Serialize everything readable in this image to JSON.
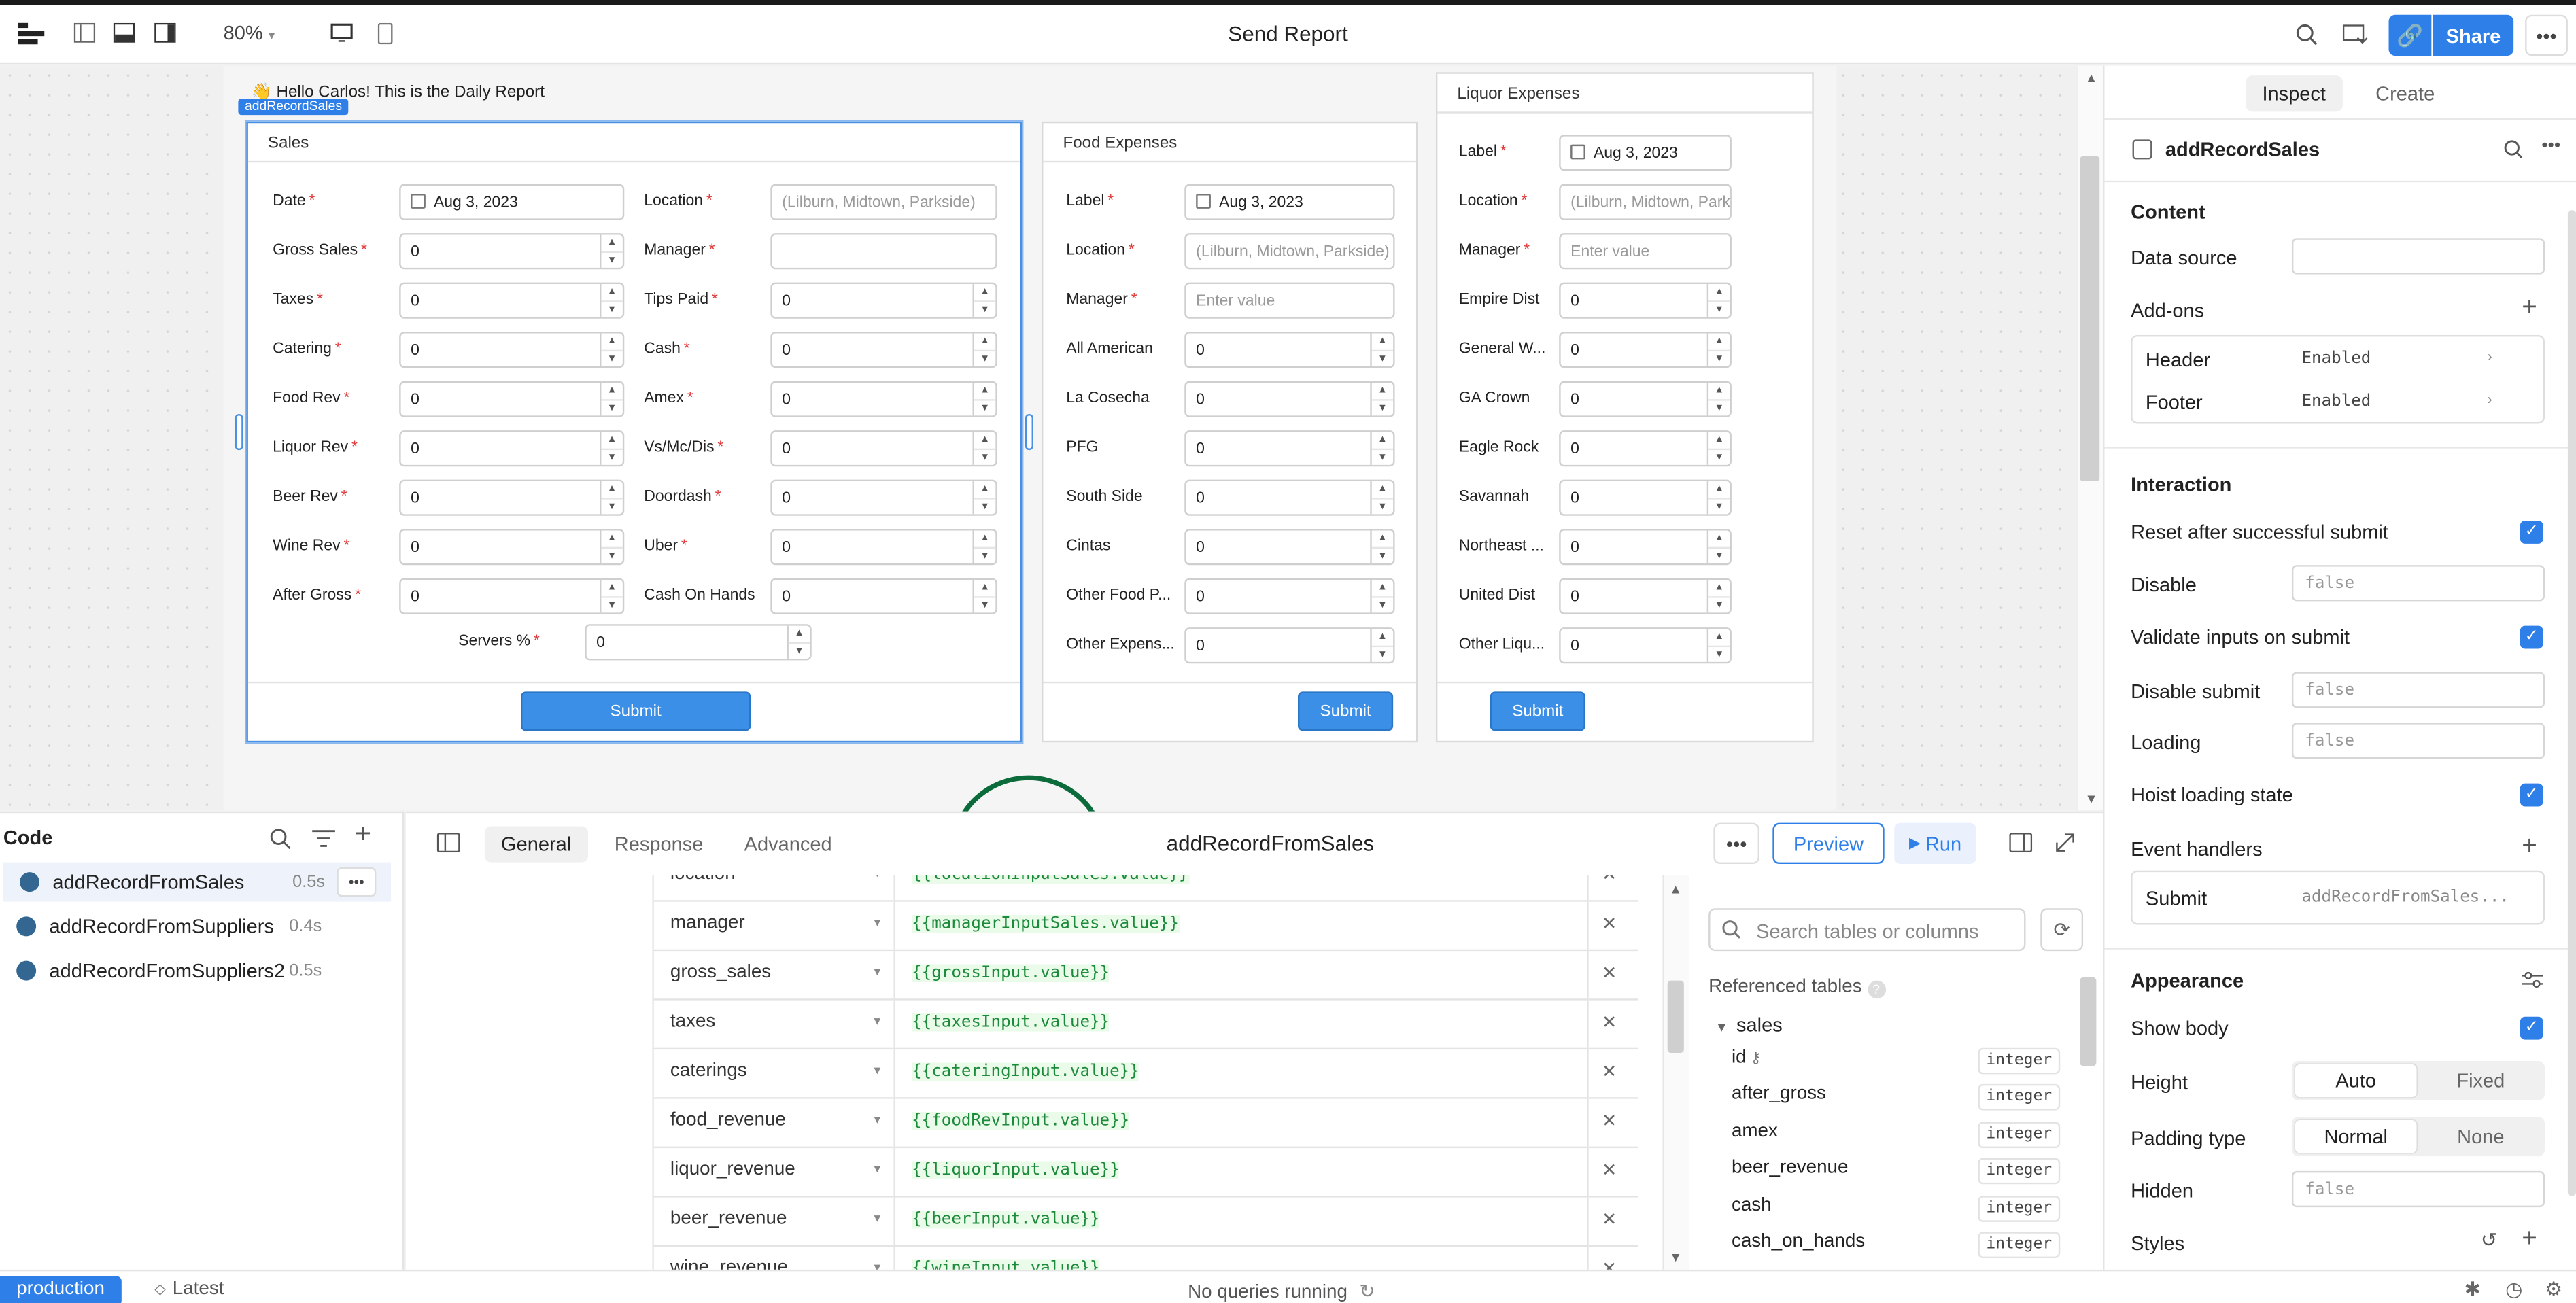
{
  "app": {
    "title": "Send Report",
    "zoom": "80%",
    "share_label": "Share"
  },
  "canvas": {
    "greeting": "👋 Hello Carlos! This is the Daily Report",
    "selected_badge": "addRecordSales"
  },
  "forms": {
    "sales": {
      "title": "Sales",
      "left_fields": [
        {
          "label": "Date",
          "required": true,
          "value": "Aug 3, 2023",
          "kind": "date"
        },
        {
          "label": "Gross Sales",
          "required": true,
          "value": "0",
          "kind": "number"
        },
        {
          "label": "Taxes",
          "required": true,
          "value": "0",
          "kind": "number"
        },
        {
          "label": "Catering",
          "required": true,
          "value": "0",
          "kind": "number"
        },
        {
          "label": "Food Rev",
          "required": true,
          "value": "0",
          "kind": "number"
        },
        {
          "label": "Liquor Rev",
          "required": true,
          "value": "0",
          "kind": "number"
        },
        {
          "label": "Beer Rev",
          "required": true,
          "value": "0",
          "kind": "number"
        },
        {
          "label": "Wine Rev",
          "required": true,
          "value": "0",
          "kind": "number"
        },
        {
          "label": "After Gross",
          "required": true,
          "value": "0",
          "kind": "number"
        }
      ],
      "right_fields": [
        {
          "label": "Location",
          "required": true,
          "value": "(Lilburn, Midtown, Parkside)",
          "kind": "placeholder"
        },
        {
          "label": "Manager",
          "required": true,
          "value": "",
          "kind": "text"
        },
        {
          "label": "Tips Paid",
          "required": true,
          "value": "0",
          "kind": "number"
        },
        {
          "label": "Cash",
          "required": true,
          "value": "0",
          "kind": "number"
        },
        {
          "label": "Amex",
          "required": true,
          "value": "0",
          "kind": "number"
        },
        {
          "label": "Vs/Mc/Dis",
          "required": true,
          "value": "0",
          "kind": "number"
        },
        {
          "label": "Doordash",
          "required": true,
          "value": "0",
          "kind": "number"
        },
        {
          "label": "Uber",
          "required": true,
          "value": "0",
          "kind": "number"
        },
        {
          "label": "Cash On Hands",
          "required": false,
          "value": "0",
          "kind": "number"
        }
      ],
      "servers": {
        "label": "Servers %",
        "required": true,
        "value": "0"
      },
      "submit_label": "Submit"
    },
    "food": {
      "title": "Food Expenses",
      "fields": [
        {
          "label": "Label",
          "required": true,
          "value": "Aug 3, 2023",
          "kind": "date"
        },
        {
          "label": "Location",
          "required": true,
          "value": "(Lilburn, Midtown, Parkside)",
          "kind": "placeholder"
        },
        {
          "label": "Manager",
          "required": true,
          "value": "Enter value",
          "kind": "placeholder"
        },
        {
          "label": "All American",
          "required": false,
          "value": "0",
          "kind": "number"
        },
        {
          "label": "La Cosecha",
          "required": false,
          "value": "0",
          "kind": "number"
        },
        {
          "label": "PFG",
          "required": false,
          "value": "0",
          "kind": "number"
        },
        {
          "label": "South Side",
          "required": false,
          "value": "0",
          "kind": "number"
        },
        {
          "label": "Cintas",
          "required": false,
          "value": "0",
          "kind": "number"
        },
        {
          "label": "Other Food P...",
          "required": false,
          "value": "0",
          "kind": "number"
        },
        {
          "label": "Other Expens...",
          "required": false,
          "value": "0",
          "kind": "number"
        }
      ],
      "submit_label": "Submit"
    },
    "liquor": {
      "title": "Liquor Expenses",
      "fields": [
        {
          "label": "Label",
          "required": true,
          "value": "Aug 3, 2023",
          "kind": "date"
        },
        {
          "label": "Location",
          "required": true,
          "value": "(Lilburn, Midtown, Parkside)",
          "kind": "placeholder"
        },
        {
          "label": "Manager",
          "required": true,
          "value": "Enter value",
          "kind": "placeholder"
        },
        {
          "label": "Empire Dist",
          "required": false,
          "value": "0",
          "kind": "number"
        },
        {
          "label": "General W...",
          "required": false,
          "value": "0",
          "kind": "number"
        },
        {
          "label": "GA Crown",
          "required": false,
          "value": "0",
          "kind": "number"
        },
        {
          "label": "Eagle Rock",
          "required": false,
          "value": "0",
          "kind": "number"
        },
        {
          "label": "Savannah",
          "required": false,
          "value": "0",
          "kind": "number"
        },
        {
          "label": "Northeast ...",
          "required": false,
          "value": "0",
          "kind": "number"
        },
        {
          "label": "United Dist",
          "required": false,
          "value": "0",
          "kind": "number"
        },
        {
          "label": "Other Liqu...",
          "required": false,
          "value": "0",
          "kind": "number"
        }
      ],
      "submit_label": "Submit"
    }
  },
  "inspector": {
    "tabs": [
      "Inspect",
      "Create"
    ],
    "component_name": "addRecordSales",
    "content_title": "Content",
    "data_source_label": "Data source",
    "addons_label": "Add-ons",
    "addons": [
      {
        "name": "Header",
        "value": "Enabled"
      },
      {
        "name": "Footer",
        "value": "Enabled"
      }
    ],
    "interaction_title": "Interaction",
    "interaction": {
      "reset_label": "Reset after successful submit",
      "disable_label": "Disable",
      "disable_value": "false",
      "validate_label": "Validate inputs on submit",
      "disable_submit_label": "Disable submit",
      "disable_submit_value": "false",
      "loading_label": "Loading",
      "loading_value": "false",
      "hoist_label": "Hoist loading state"
    },
    "event_handlers_label": "Event handlers",
    "event_handler": {
      "event": "Submit",
      "action": "addRecordFromSales..."
    },
    "appearance_title": "Appearance",
    "appearance": {
      "show_body_label": "Show body",
      "height_label": "Height",
      "height_options": [
        "Auto",
        "Fixed"
      ],
      "padding_label": "Padding type",
      "padding_options": [
        "Normal",
        "None"
      ],
      "hidden_label": "Hidden",
      "hidden_value": "false",
      "styles_label": "Styles"
    }
  },
  "code": {
    "title": "Code",
    "queries": [
      {
        "name": "addRecordFromSales",
        "time": "0.5s"
      },
      {
        "name": "addRecordFromSuppliers",
        "time": "0.4s"
      },
      {
        "name": "addRecordFromSuppliers2",
        "time": "0.5s"
      }
    ]
  },
  "editor": {
    "tabs": [
      "General",
      "Response",
      "Advanced"
    ],
    "title": "addRecordFromSales",
    "preview_label": "Preview",
    "run_label": "Run",
    "mappings": [
      {
        "column": "location",
        "value": "{{locationInputSales.value}}"
      },
      {
        "column": "manager",
        "value": "{{managerInputSales.value}}"
      },
      {
        "column": "gross_sales",
        "value": "{{grossInput.value}}"
      },
      {
        "column": "taxes",
        "value": "{{taxesInput.value}}"
      },
      {
        "column": "caterings",
        "value": "{{cateringInput.value}}"
      },
      {
        "column": "food_revenue",
        "value": "{{foodRevInput.value}}"
      },
      {
        "column": "liquor_revenue",
        "value": "{{liquorInput.value}}"
      },
      {
        "column": "beer_revenue",
        "value": "{{beerInput.value}}"
      },
      {
        "column": "wine_revenue",
        "value": "{{wineInput.value}}"
      }
    ]
  },
  "schema": {
    "search_placeholder": "Search tables or columns",
    "referenced_label": "Referenced tables",
    "table": "sales",
    "columns": [
      {
        "name": "id",
        "type": "integer"
      },
      {
        "name": "after_gross",
        "type": "integer"
      },
      {
        "name": "amex",
        "type": "integer"
      },
      {
        "name": "beer_revenue",
        "type": "integer"
      },
      {
        "name": "cash",
        "type": "integer"
      },
      {
        "name": "cash_on_hands",
        "type": "integer"
      }
    ]
  },
  "status": {
    "environment": "production",
    "branch": "Latest",
    "queries_status": "No queries running"
  },
  "colors": {
    "accent": "#2f7fe8",
    "required": "#e03a3a",
    "code_green": "#1b8a3a"
  }
}
